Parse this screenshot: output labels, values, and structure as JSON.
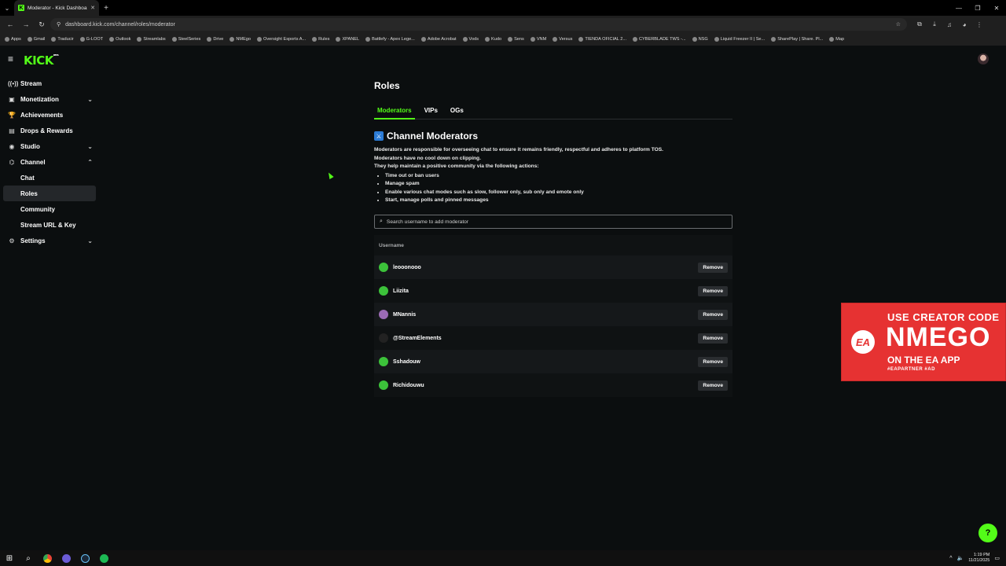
{
  "browser": {
    "tab_title": "Moderator - Kick Dashboard",
    "url": "dashboard.kick.com/channel/roles/moderator",
    "bookmarks": [
      "Apps",
      "Gmail",
      "Traducir",
      "G-LOOT",
      "Outlook",
      "Streamlabs",
      "SteelSeries",
      "Drive",
      "NMEgo",
      "Oversight Esports A...",
      "Rules",
      "XPANEL",
      "Battlefy - Apex Lege...",
      "Adobe Acrobat",
      "Vods",
      "Kudo",
      "Sens",
      "VNM",
      "Versus",
      "TIENDA OFICIAL 2...",
      "CYBERBLADE TWS -...",
      "NSG",
      "Liquid Freezer II | Se...",
      "SharePlay | Share. Pl...",
      "Map"
    ]
  },
  "app": {
    "logo": "KICK",
    "logo_badge": "BETA"
  },
  "sidebar": {
    "items": [
      {
        "label": "Stream",
        "icon": "broadcast-icon",
        "glyph": "((•))"
      },
      {
        "label": "Monetization",
        "icon": "wallet-icon",
        "glyph": "▣",
        "chevron": "down"
      },
      {
        "label": "Achievements",
        "icon": "trophy-icon",
        "glyph": "🏆"
      },
      {
        "label": "Drops & Rewards",
        "icon": "gift-icon",
        "glyph": "▤"
      },
      {
        "label": "Studio",
        "icon": "studio-icon",
        "glyph": "◉",
        "chevron": "down"
      },
      {
        "label": "Channel",
        "icon": "channel-icon",
        "glyph": "⌬",
        "chevron": "up"
      },
      {
        "label": "Chat",
        "sub": true
      },
      {
        "label": "Roles",
        "sub": true,
        "active": true
      },
      {
        "label": "Community",
        "sub": true
      },
      {
        "label": "Stream URL & Key",
        "sub": true
      },
      {
        "label": "Settings",
        "icon": "gear-icon",
        "glyph": "⚙",
        "chevron": "down"
      }
    ]
  },
  "main": {
    "title": "Roles",
    "tabs": [
      {
        "label": "Moderators",
        "active": true
      },
      {
        "label": "VIPs"
      },
      {
        "label": "OGs"
      }
    ],
    "section_title": "Channel Moderators",
    "description": {
      "lines": [
        "Moderators are responsible for overseeing chat to ensure it remains friendly, respectful and adheres to platform TOS.",
        "Moderators have no cool down on clipping.",
        "They help maintain a positive community via the following actions:"
      ],
      "bullets": [
        "Time out or ban users",
        "Manage spam",
        "Enable various chat modes such as slow, follower only, sub only and emote only",
        "Start, manage polls and pinned messages"
      ]
    },
    "search": {
      "placeholder": "Search username to add moderator",
      "value": ""
    },
    "table": {
      "header": "Username",
      "remove_label": "Remove",
      "rows": [
        {
          "username": "leooonooo",
          "avatar_color": "#3cc23a"
        },
        {
          "username": "Liizita",
          "avatar_color": "#3cc23a"
        },
        {
          "username": "MNannis",
          "avatar_color": "#9b6bb5"
        },
        {
          "username": "@StreamElements",
          "avatar_color": "#222222"
        },
        {
          "username": "Sshadouw",
          "avatar_color": "#3cc23a"
        },
        {
          "username": "Richidouwu",
          "avatar_color": "#3cc23a"
        }
      ]
    }
  },
  "overlay": {
    "logo": "EA",
    "line1": "USE CREATOR CODE",
    "line2": "NMEGO",
    "line3": "ON THE EA APP",
    "line4": "#EAPARTNER #AD"
  },
  "taskbar": {
    "time": "1:19 PM",
    "date": "11/21/2025"
  },
  "colors": {
    "accent": "#53fc18",
    "background": "#0b0e0f",
    "ea_red": "#e63232"
  }
}
